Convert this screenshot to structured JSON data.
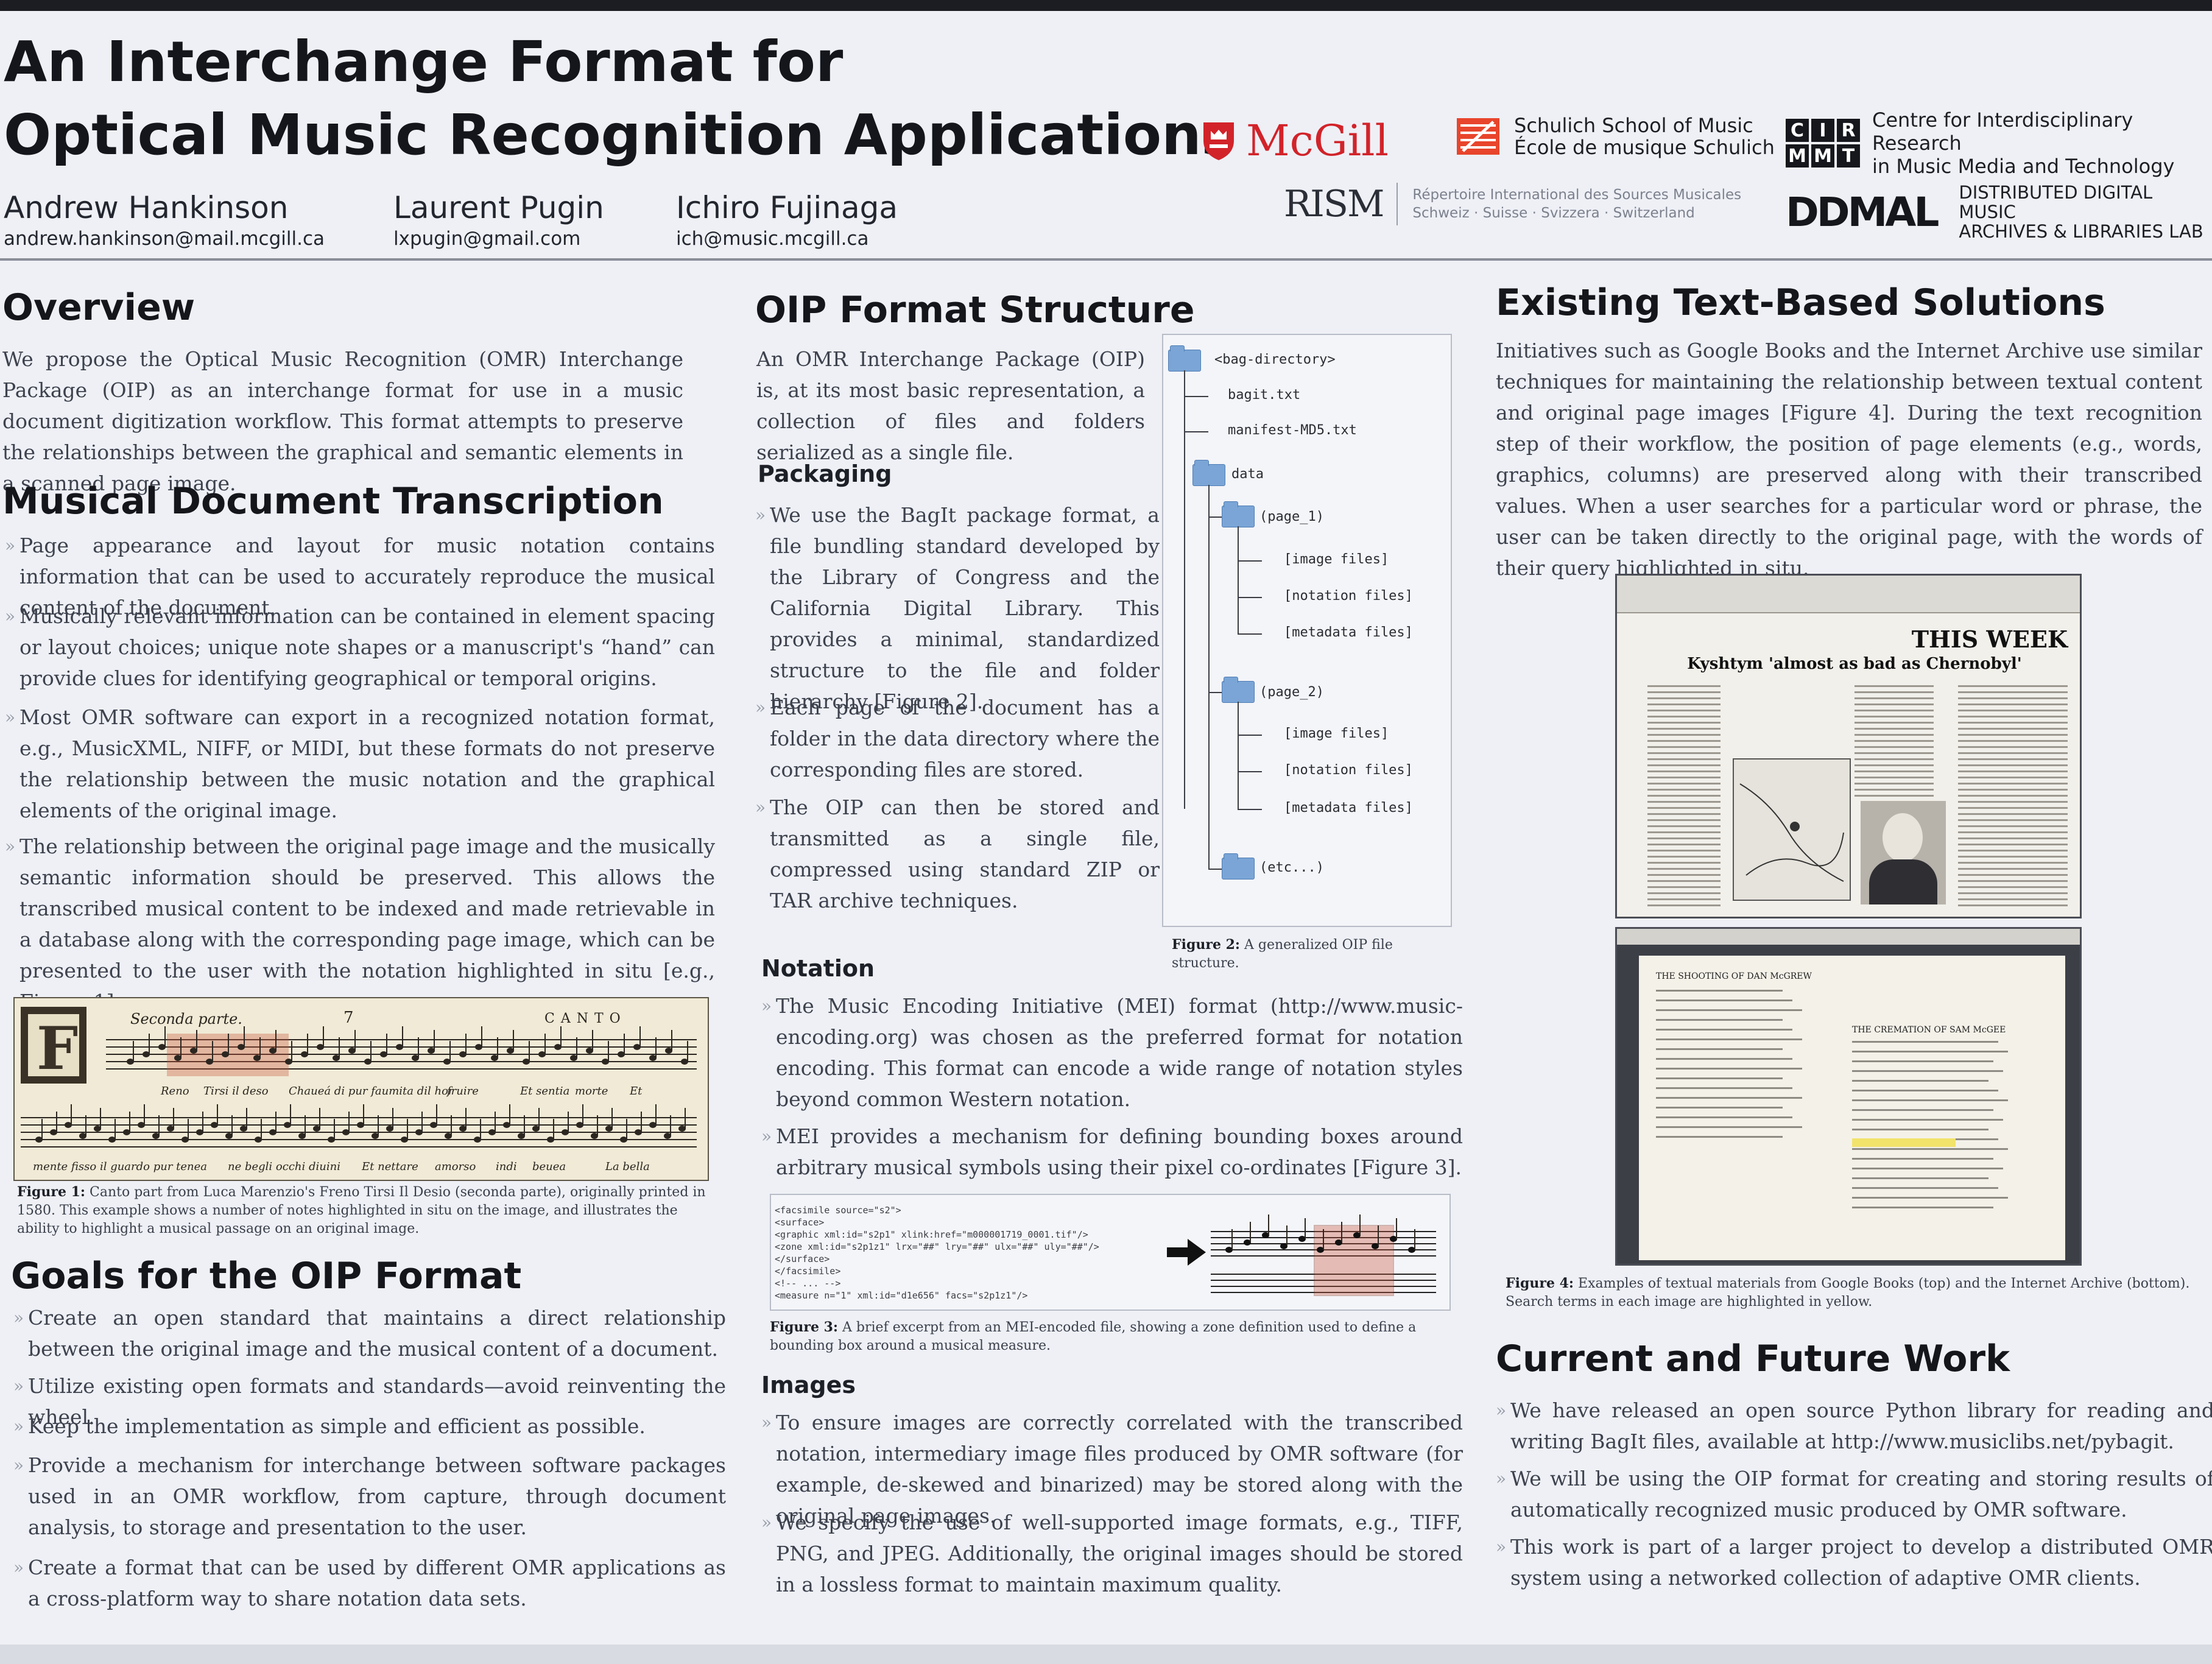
{
  "header": {
    "title_line1": "An Interchange Format for",
    "title_line2": "Optical Music Recognition Applications",
    "authors": [
      {
        "name": "Andrew Hankinson",
        "email": "andrew.hankinson@mail.mcgill.ca"
      },
      {
        "name": "Laurent Pugin",
        "email": "lxpugin@gmail.com"
      },
      {
        "name": "Ichiro Fujinaga",
        "email": "ich@music.mcgill.ca"
      }
    ],
    "logos": {
      "mcgill": "McGill",
      "schulich_line1": "Schulich School of Music",
      "schulich_line2": "École de musique Schulich",
      "cirmmt_letters": [
        "C",
        "I",
        "R",
        "M",
        "M",
        "T"
      ],
      "cirmmt_line1": "Centre for Interdisciplinary Research",
      "cirmmt_line2": "in Music Media and Technology",
      "rism_mark": "RISM",
      "rism_line1": "Répertoire International des Sources Musicales",
      "rism_line2": "Schweiz · Suisse · Svizzera · Switzerland",
      "ddmal_mark": "DDMAL",
      "ddmal_line1": "DISTRIBUTED DIGITAL MUSIC",
      "ddmal_line2": "ARCHIVES & LIBRARIES LAB"
    }
  },
  "overview": {
    "heading": "Overview",
    "text": "We propose the Optical Music Recognition (OMR) Interchange Package (OIP) as an interchange format for use in a music document digitization workflow. This format attempts to preserve the relationships between the graphical and semantic elements in a scanned page image."
  },
  "transcription": {
    "heading": "Musical Document Transcription",
    "bullets": [
      "Page appearance and layout for music notation contains information that can be used to accurately reproduce the musical content of the document.",
      "Musically relevant information can be contained in element spacing or layout choices; unique note shapes or a manuscript's “hand” can provide clues for identifying geographical or temporal origins.",
      "Most OMR software can export in a recognized notation format, e.g., MusicXML, NIFF, or MIDI, but these formats do not preserve the relationship between the music notation and the graphical elements of the original image.",
      "The relationship between the original page image and the musically semantic information should be preserved. This allows the transcribed musical content to be indexed and made retrievable in a database along with the corresponding page image, which can be presented to the user with the notation highlighted in situ [e.g., Figure 1]."
    ],
    "figure1": {
      "part_label": "Seconda parte.",
      "voice_label": "CANTO",
      "measure_number": "7",
      "lyrics_row1": [
        "Reno",
        "Tirsi il deso",
        "Chaueá di pur faumita dil hor",
        "fruire",
        "Et sentia",
        "morte",
        "Et"
      ],
      "lyrics_row2": [
        "mente fisso il guardo pur tenea",
        "ne begli occhi diuini",
        "Et nettare",
        "amorso",
        "indi",
        "beuea",
        "La bella"
      ],
      "caption_label": "Figure 1:",
      "caption_text": "Canto part from Luca Marenzio's Freno Tirsi Il Desio (seconda parte), originally printed in 1580. This example shows a number of notes highlighted in situ on the image, and illustrates the ability to highlight a musical passage on an original image."
    }
  },
  "goals": {
    "heading": "Goals for the OIP Format",
    "bullets": [
      "Create an open standard that maintains a direct relationship between the original image and the musical content of a document.",
      "Utilize existing open formats and standards—avoid reinventing the wheel.",
      "Keep the implementation as simple and efficient as possible.",
      "Provide a mechanism for interchange between software packages used in an OMR workflow, from capture, through document analysis, to storage and presentation to the user.",
      "Create a format that can be used by different OMR applications as a cross-platform way to share notation data sets."
    ]
  },
  "structure": {
    "heading": "OIP Format Structure",
    "intro": "An OMR Interchange Package (OIP) is, at its most basic representation, a collection of files and folders serialized as a single file.",
    "packaging_heading": "Packaging",
    "packaging_bullets": [
      "We use the BagIt package format, a file bundling standard developed by the Library of Congress and the California Digital Library. This provides a minimal, standardized structure to the file and folder hierarchy [Figure 2].",
      "Each page of the document has a folder in the data directory where the corresponding files are stored.",
      "The OIP can then be stored and transmitted as a single file, compressed using standard ZIP or TAR archive techniques."
    ],
    "tree": {
      "root": "<bag-directory>",
      "bagit": "bagit.txt",
      "manifest": "manifest-MD5.txt",
      "data": "data",
      "page1": "(page_1)",
      "page2": "(page_2)",
      "image_files": "[image files]",
      "notation_files": "[notation files]",
      "metadata_files": "[metadata files]",
      "etc": "(etc...)"
    },
    "figure2_label": "Figure 2:",
    "figure2_text": "A generalized OIP file structure.",
    "notation_heading": "Notation",
    "notation_bullets": [
      "The Music Encoding Initiative (MEI) format (http://www.music-encoding.org) was chosen as the preferred format for notation encoding. This format can encode a wide range of notation styles beyond common Western notation.",
      "MEI provides a mechanism for defining bounding boxes around arbitrary musical symbols using their pixel co-ordinates [Figure 3]."
    ],
    "figure3_code": [
      "<facsimile source=\"s2\">",
      "  <surface>",
      "    <graphic xml:id=\"s2p1\" xlink:href=\"m000001719_0001.tif\"/>",
      "    <zone xml:id=\"s2p1z1\" lrx=\"##\" lry=\"##\" ulx=\"##\" uly=\"##\"/>",
      "  </surface>",
      "</facsimile>",
      "<!-- ... -->",
      "<measure n=\"1\" xml:id=\"d1e656\" facs=\"s2p1z1\"/>"
    ],
    "figure3_label": "Figure 3:",
    "figure3_text": "A brief excerpt from an MEI-encoded file, showing a zone definition used to define a bounding box around a musical measure.",
    "images_heading": "Images",
    "images_bullets": [
      "To ensure images are correctly correlated with the transcribed notation, intermediary image files produced by OMR software (for example, de-skewed and binarized) may be stored along with the original page images.",
      "We specify the use of well-supported image formats, e.g., TIFF, PNG, and JPEG. Additionally, the original images should be stored in a lossless format to maintain maximum quality."
    ]
  },
  "existing": {
    "heading": "Existing Text-Based Solutions",
    "text": "Initiatives such as Google Books and the Internet Archive use similar techniques for maintaining the relationship between textual content and original page images [Figure 4]. During the text recognition step of their workflow, the position of page elements (e.g., words, graphics, columns) are preserved along with their transcribed values. When a user searches for a particular word or phrase, the user can be taken directly to the original page, with the words of their query highlighted in situ.",
    "gb_headline": "THIS WEEK",
    "gb_subhead": "Kyshtym 'almost as bad as Chernobyl'",
    "ia_title_left": "THE SHOOTING OF DAN McGREW",
    "ia_title_right": "THE CREMATION OF SAM McGEE",
    "figure4_label": "Figure 4:",
    "figure4_text": "Examples of textual materials from Google Books (top) and the Internet Archive (bottom). Search terms in each image are highlighted in yellow."
  },
  "future": {
    "heading": "Current and Future Work",
    "bullets": [
      "We have released an open source Python library for reading and writing BagIt files, available at http://www.musiclibs.net/pybagit.",
      "We will be using the OIP format for creating and storing results of automatically recognized music produced by OMR software.",
      "This work is part of a larger project to develop a distributed OMR system using a networked collection of adaptive OMR clients."
    ]
  },
  "colors": {
    "mcgill_red": "#d2232a",
    "folder_blue": "#7aa5d6",
    "highlight_red": "#c8553a",
    "highlight_yellow": "#f2e36b"
  }
}
